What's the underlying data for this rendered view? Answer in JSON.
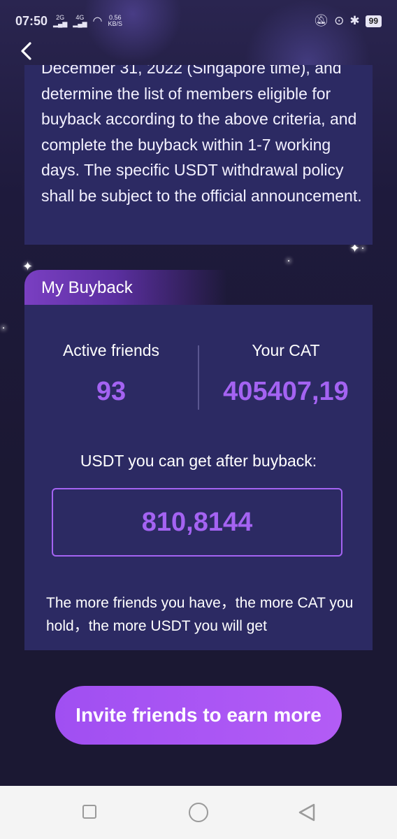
{
  "status_bar": {
    "time": "07:50",
    "network_1": "2G",
    "network_2": "4G",
    "speed": "0.56",
    "speed_unit": "KB/S",
    "battery": "99"
  },
  "policy": {
    "text": "December 31, 2022 (Singapore time), and determine the list of members eligible for buyback according to the above criteria, and complete the buyback within 1-7 working days. The specific USDT withdrawal policy shall be subject to the official announcement."
  },
  "buyback": {
    "title": "My Buyback",
    "active_friends_label": "Active friends",
    "active_friends_value": "93",
    "your_cat_label": "Your CAT",
    "your_cat_value": "405407,19",
    "usdt_label": "USDT you can get after buyback:",
    "usdt_value": "810,8144",
    "note": "The more friends you have，the more CAT you hold，the more USDT you will get"
  },
  "invite_button": "Invite friends to earn more",
  "icons": {
    "back": "chevron-left-icon",
    "nav_recent": "square-icon",
    "nav_home": "circle-icon",
    "nav_back": "triangle-back-icon"
  },
  "colors": {
    "accent": "#a463f2",
    "card": "#2c2a63",
    "background": "#1b1833"
  }
}
